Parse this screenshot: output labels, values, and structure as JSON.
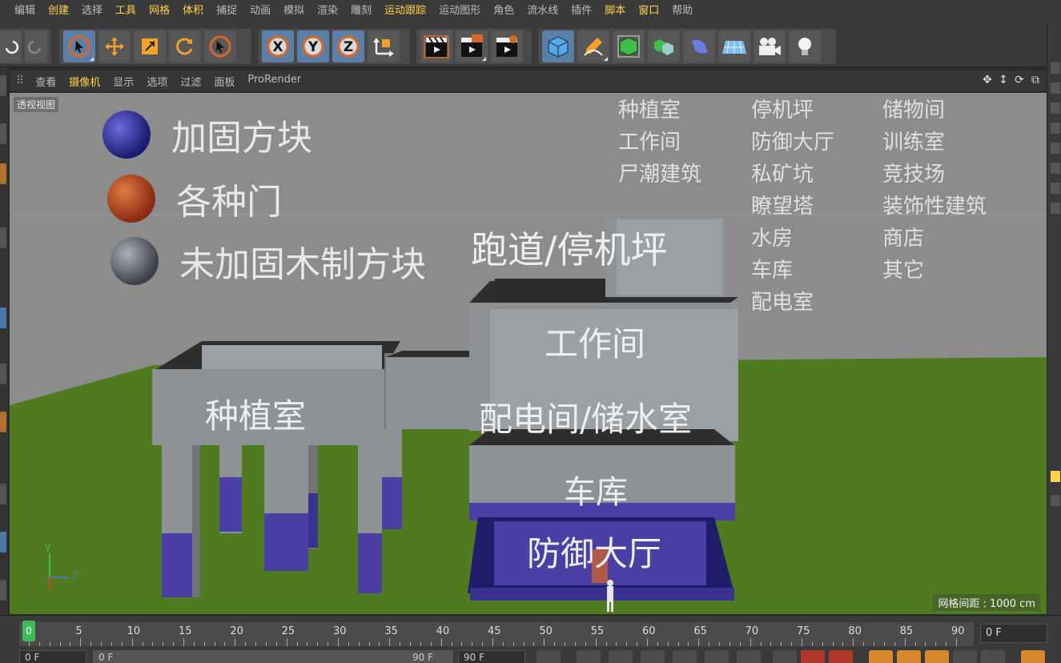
{
  "menu": [
    "编辑",
    "创建",
    "选择",
    "工具",
    "网格",
    "体积",
    "捕捉",
    "动画",
    "模拟",
    "渲染",
    "雕刻",
    "运动跟踪",
    "运动图形",
    "角色",
    "流水线",
    "插件",
    "脚本",
    "窗口",
    "帮助"
  ],
  "viewport_menu": [
    "查看",
    "摄像机",
    "显示",
    "选项",
    "过滤",
    "面板",
    "ProRender"
  ],
  "viewport": {
    "view_label": "透视视图",
    "grid_spacing": "网格间距 : 1000 cm",
    "axis": {
      "y": "Y",
      "z": "Z",
      "x": "X"
    }
  },
  "legend": [
    {
      "label": "加固方块",
      "color": "#2a2a8a"
    },
    {
      "label": "各种门",
      "color": "#b5401a"
    },
    {
      "label": "未加固木制方块",
      "color": "#5a6068"
    }
  ],
  "rooms": {
    "col1": [
      "种植室",
      "工作间",
      "尸潮建筑"
    ],
    "col2": [
      "停机坪",
      "防御大厅",
      "私矿坑",
      "瞭望塔",
      "水房",
      "车库",
      "配电室"
    ],
    "col3": [
      "储物间",
      "训练室",
      "竞技场",
      "装饰性建筑",
      "商店",
      "其它"
    ]
  },
  "buildings": {
    "runway": "跑道/停机坪",
    "workshop": "工作间",
    "power": "配电间/储水室",
    "garage": "车库",
    "defense": "防御大厅",
    "greenhouse": "种植室"
  },
  "timeline": {
    "ticks": [
      "0",
      "5",
      "10",
      "15",
      "20",
      "25",
      "30",
      "35",
      "40",
      "45",
      "50",
      "55",
      "60",
      "65",
      "70",
      "75",
      "80",
      "85",
      "90"
    ],
    "current_frame": "0",
    "frame_field": "0 F"
  },
  "bottom": {
    "field1": "0 F",
    "field2": "0 F",
    "field3": "90 F",
    "field4": "90 F"
  },
  "colors": {
    "accent": "#ffd24a",
    "ground": "#4f7a1f",
    "concrete": "#8d9296",
    "reinforced": "#4a3fa5"
  }
}
